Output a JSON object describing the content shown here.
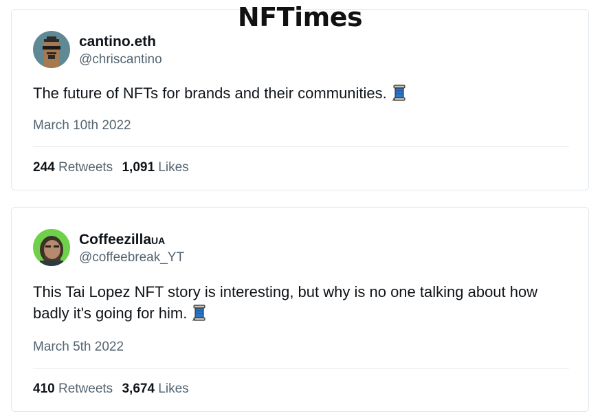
{
  "site": {
    "title": "NFTimes"
  },
  "tweets": [
    {
      "name": "cantino.eth",
      "badge": "",
      "handle": "@chriscantino",
      "text": "The future of NFTs for brands and their communities.",
      "emoji": "spool-of-thread-icon",
      "date": "March 10th 2022",
      "retweets": "244",
      "retweets_label": "Retweets",
      "likes": "1,091",
      "likes_label": "Likes"
    },
    {
      "name": "Coffeezilla",
      "badge": "UA",
      "handle": "@coffeebreak_YT",
      "text": "This Tai Lopez NFT story is interesting, but why is no one talking about how badly it's going for him.",
      "emoji": "spool-of-thread-icon",
      "date": "March 5th 2022",
      "retweets": "410",
      "retweets_label": "Retweets",
      "likes": "3,674",
      "likes_label": "Likes"
    }
  ],
  "colors": {
    "text": "#0f1419",
    "secondary": "#536471",
    "border": "#e1e8ed",
    "avatar1_bg": "#5f8a95",
    "avatar2_bg": "#6fd14a"
  }
}
